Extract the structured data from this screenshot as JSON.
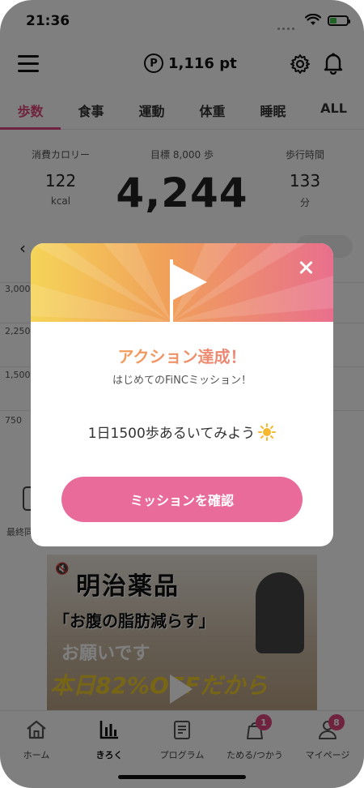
{
  "status_bar": {
    "time": "21:36"
  },
  "header": {
    "points": "1,116 pt",
    "points_symbol": "P"
  },
  "tabs": [
    {
      "label": "歩数",
      "active": true
    },
    {
      "label": "食事"
    },
    {
      "label": "運動"
    },
    {
      "label": "体重"
    },
    {
      "label": "睡眠"
    },
    {
      "label": "ALL"
    }
  ],
  "stats": {
    "left": {
      "label": "消費カロリー",
      "value": "122",
      "unit": "kcal"
    },
    "center": {
      "label": "目標 8,000 歩",
      "value": "4,244"
    },
    "right": {
      "label": "歩行時間",
      "value": "133",
      "unit": "分"
    }
  },
  "graph": {
    "labels": [
      "3,000",
      "2,250",
      "1,500",
      "750"
    ]
  },
  "last_label": "最終同",
  "ad": {
    "line1": "明治薬品",
    "line2": "「お腹の脂肪減らす」",
    "line3": "お願いです",
    "line4": "本日82%OFFだから"
  },
  "bottom_nav": [
    {
      "label": "ホーム"
    },
    {
      "label": "きろく",
      "active": true
    },
    {
      "label": "プログラム"
    },
    {
      "label": "ためる/つかう",
      "badge": "1"
    },
    {
      "label": "マイページ",
      "badge": "8"
    }
  ],
  "modal": {
    "title": "アクション達成！",
    "subtitle": "はじめてのFiNCミッション！",
    "mission": "1日1500歩あるいてみよう",
    "button": "ミッションを確認"
  },
  "colors": {
    "accent": "#e0467c",
    "button": "#e96b9a"
  }
}
